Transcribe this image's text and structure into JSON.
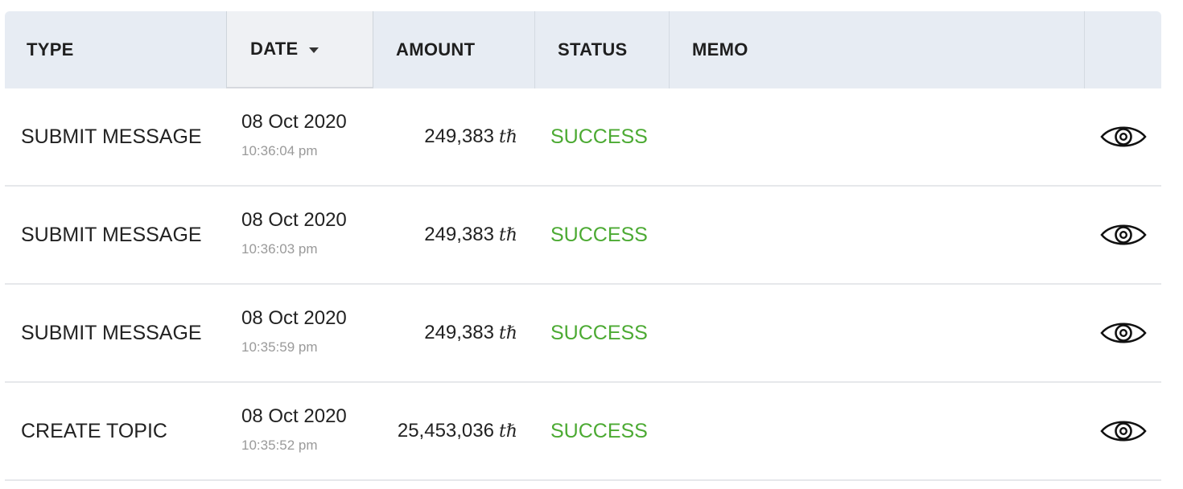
{
  "table": {
    "headers": {
      "type": "TYPE",
      "date": "DATE",
      "amount": "AMOUNT",
      "status": "STATUS",
      "memo": "MEMO"
    },
    "sort": {
      "column": "date",
      "direction": "desc",
      "icon": "caret-down-icon"
    },
    "rows": [
      {
        "type": "SUBMIT MESSAGE",
        "date": "08 Oct 2020",
        "time": "10:36:04 pm",
        "amount": "249,383",
        "unit": "tℏ",
        "status": "SUCCESS",
        "memo": ""
      },
      {
        "type": "SUBMIT MESSAGE",
        "date": "08 Oct 2020",
        "time": "10:36:03 pm",
        "amount": "249,383",
        "unit": "tℏ",
        "status": "SUCCESS",
        "memo": ""
      },
      {
        "type": "SUBMIT MESSAGE",
        "date": "08 Oct 2020",
        "time": "10:35:59 pm",
        "amount": "249,383",
        "unit": "tℏ",
        "status": "SUCCESS",
        "memo": ""
      },
      {
        "type": "CREATE TOPIC",
        "date": "08 Oct 2020",
        "time": "10:35:52 pm",
        "amount": "25,453,036",
        "unit": "tℏ",
        "status": "SUCCESS",
        "memo": ""
      }
    ],
    "row_action_icon": "eye-icon"
  },
  "colors": {
    "header_bg": "#e7ecf3",
    "status_success": "#4caa33",
    "secondary_text": "#9a9a9a"
  }
}
